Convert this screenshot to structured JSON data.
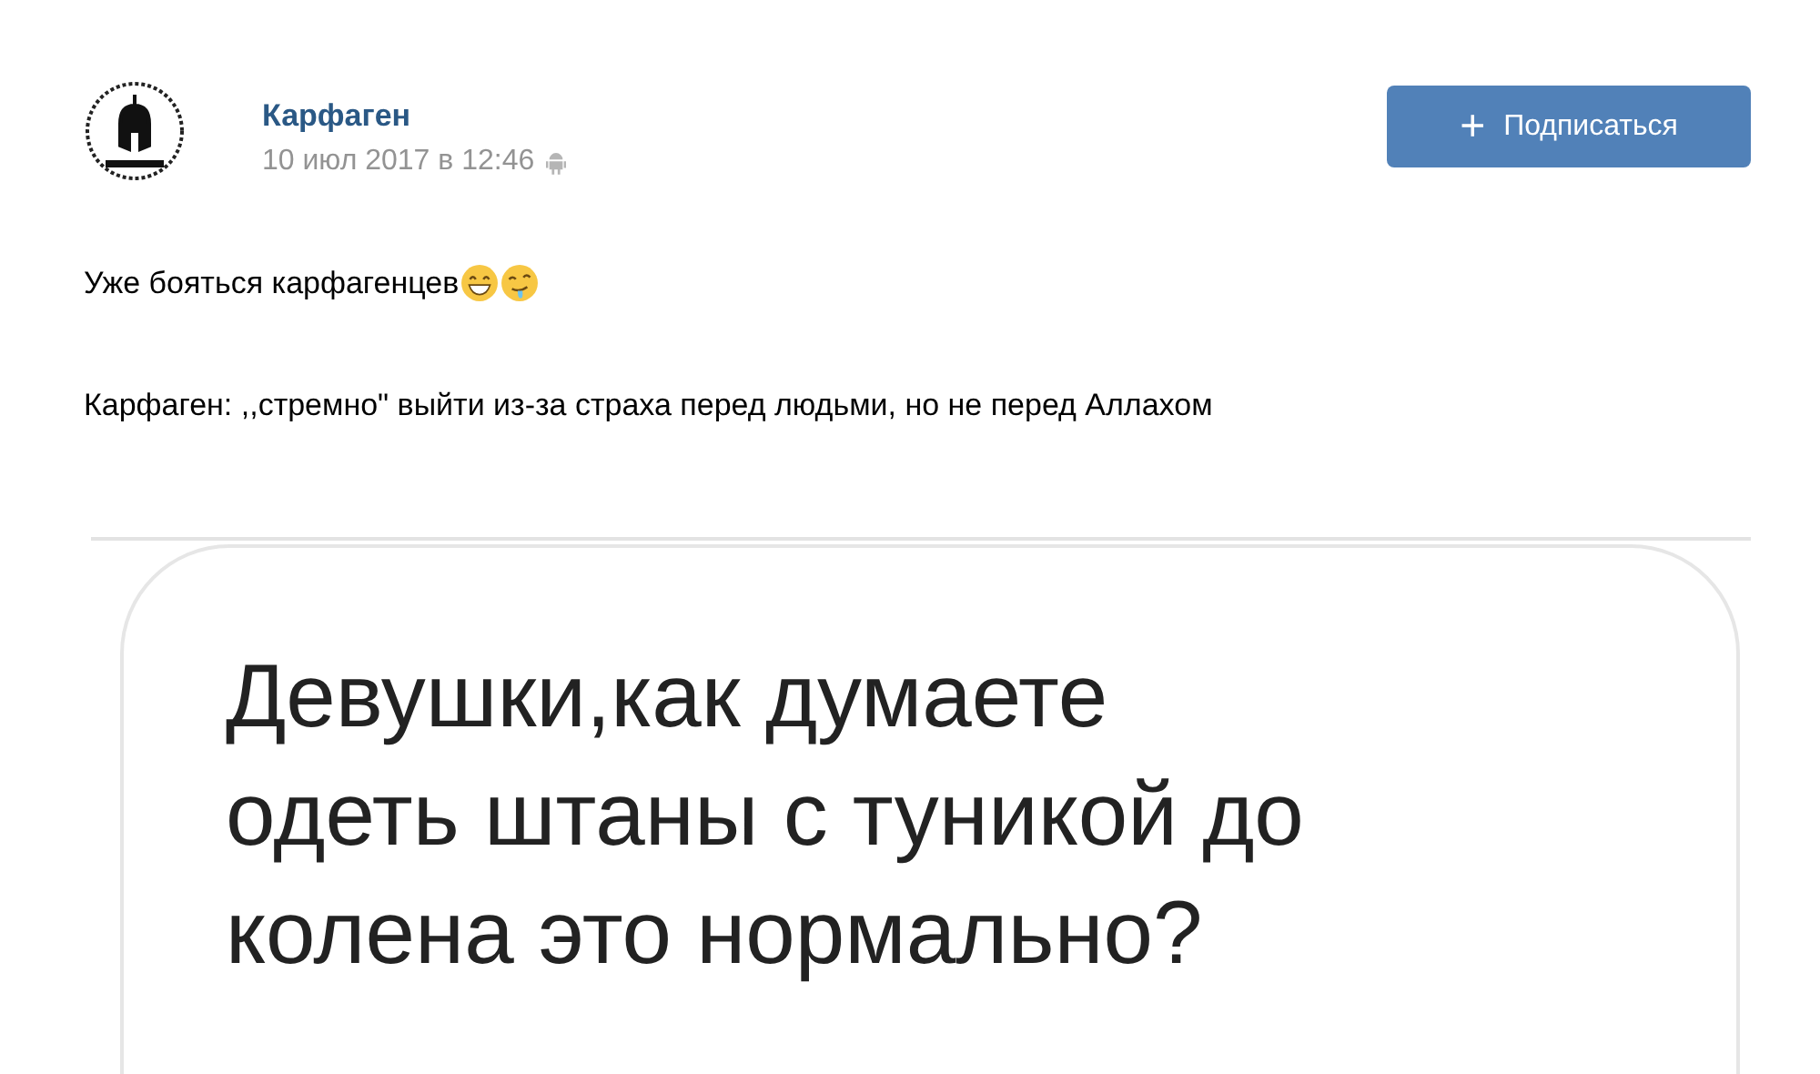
{
  "post": {
    "author": "Карфаген",
    "date": "10 июл 2017 в 12:46",
    "subscribe_button": {
      "icon": "+",
      "label": "Подписаться"
    },
    "paragraphs": [
      "Уже бояться карфагенцев",
      "Карфаген: ,,стремно\" выйти из-за страха перед людьми, но не перед Аллахом"
    ],
    "attachment": {
      "lines": [
        "Девушки,как думаете",
        "одеть штаны с туникой до",
        "колена это нормально?"
      ]
    }
  }
}
